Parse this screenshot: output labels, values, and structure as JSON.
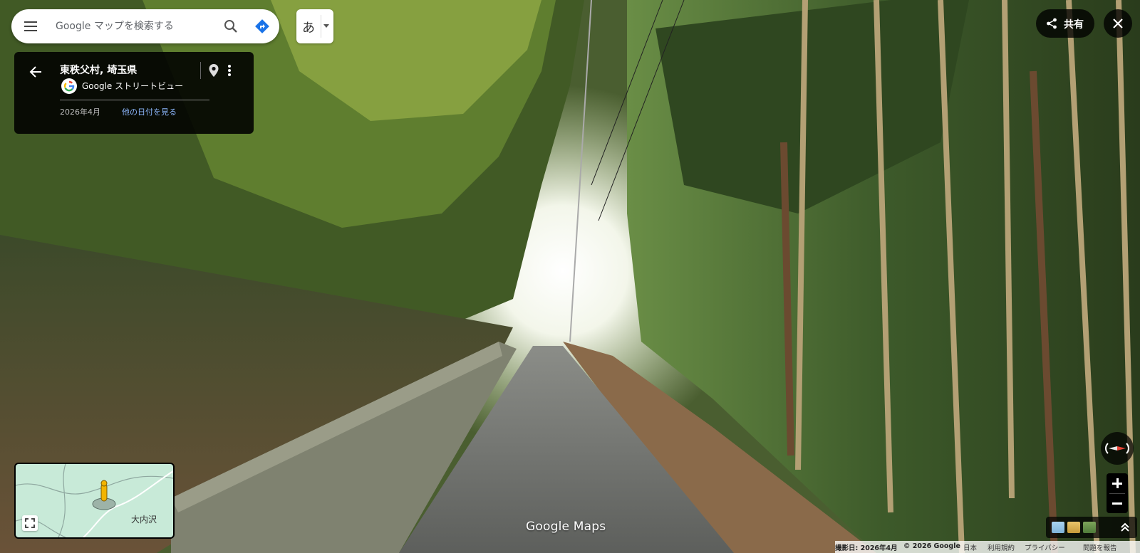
{
  "search": {
    "placeholder": "Google マップを検索する"
  },
  "ime": {
    "char": "あ"
  },
  "location_card": {
    "title": "東秩父村, 埼玉県",
    "source_label": "Google ストリートビュー",
    "date": "2026年4月",
    "other_dates_link": "他の日付を見る"
  },
  "top_right": {
    "share_label": "共有"
  },
  "minimap": {
    "place_label": "大内沢"
  },
  "logo": {
    "text": "Google Maps"
  },
  "footer": {
    "capture_date": "撮影日: 2026年4月",
    "copyright": "© 2026 Google",
    "country": "日本",
    "terms": "利用規約",
    "privacy": "プライバシー",
    "report": "問題を報告"
  },
  "icons": [
    "menu-icon",
    "search-icon",
    "directions-icon",
    "back-arrow-icon",
    "google-logo-icon",
    "pin-icon",
    "more-vert-icon",
    "share-icon",
    "close-icon",
    "compass-icon",
    "zoom-in-icon",
    "zoom-out-icon",
    "layers-icon",
    "expand-icon",
    "fullscreen-icon",
    "pegman-icon"
  ],
  "colors": {
    "link": "#8ab4f8",
    "directions": "#1a73e8",
    "minimap_bg": "#c8ead8",
    "compass_red": "#ea4335"
  }
}
